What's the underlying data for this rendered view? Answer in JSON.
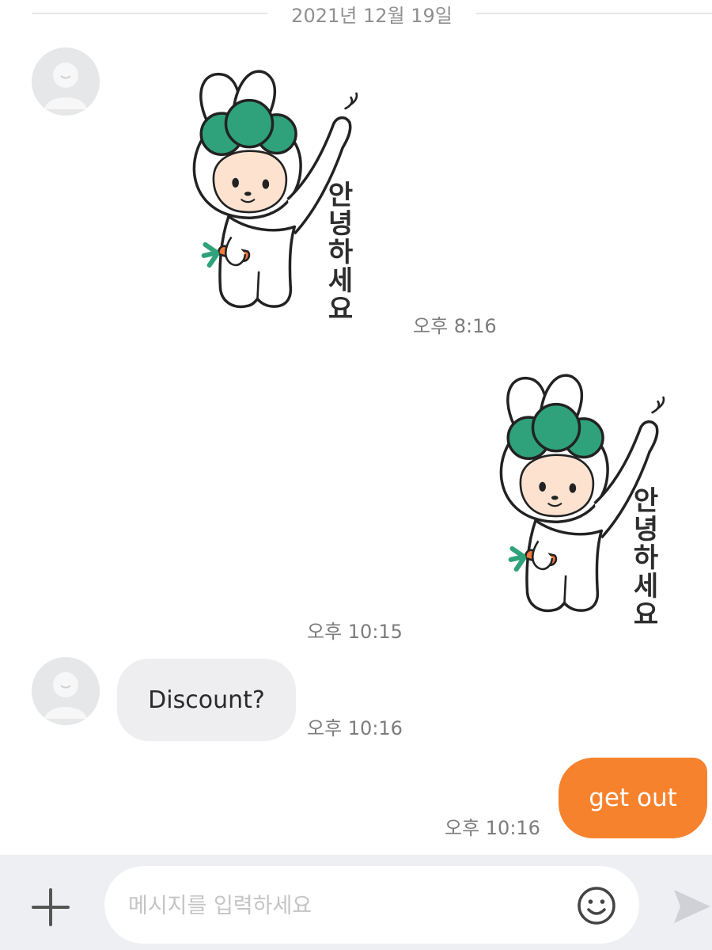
{
  "chat": {
    "date_divider": "2021년 12월 19일",
    "messages": [
      {
        "direction": "incoming",
        "type": "sticker",
        "sticker_text": "안녕하세요",
        "time": "오후 8:16"
      },
      {
        "direction": "outgoing",
        "type": "sticker",
        "sticker_text": "안녕하세요",
        "time": "오후 10:15"
      },
      {
        "direction": "incoming",
        "type": "text",
        "text": "Discount?",
        "time": "오후 10:16"
      },
      {
        "direction": "outgoing",
        "type": "text",
        "text": "get out",
        "time": "오후 10:16"
      }
    ]
  },
  "composer": {
    "placeholder": "메시지를 입력하세요"
  },
  "colors": {
    "accent_orange": "#f7822d",
    "incoming_bubble": "#eeeef0",
    "sticker_green": "#2fa27c",
    "carrot_orange": "#f47a3a",
    "face_peach": "#fde2d0"
  },
  "icons": {
    "add": "plus-icon",
    "emoji": "smiley-icon",
    "send": "send-arrow-icon",
    "avatar": "default-avatar-icon"
  }
}
